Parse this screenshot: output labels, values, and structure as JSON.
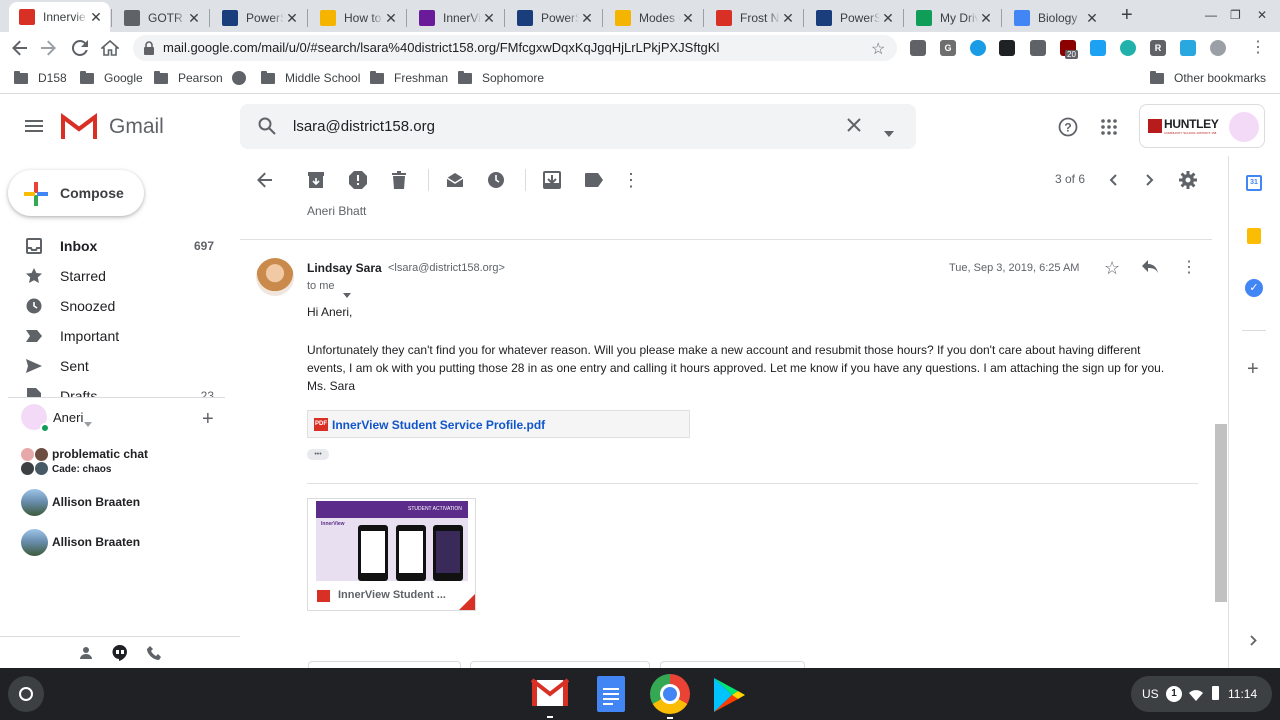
{
  "browser": {
    "tabs": [
      {
        "label": "Innervie",
        "icon": "gmail-icon",
        "color": "#d93025"
      },
      {
        "label": "GOTR Le",
        "icon": "globe-icon",
        "color": "#5f6368"
      },
      {
        "label": "PowerS",
        "icon": "powerschool-icon",
        "color": "#1a3d7c"
      },
      {
        "label": "How to",
        "icon": "slides-icon",
        "color": "#f4b400"
      },
      {
        "label": "InnerVie",
        "icon": "innerview-icon",
        "color": "#6a1b9a"
      },
      {
        "label": "PowerS",
        "icon": "powerschool-icon",
        "color": "#1a3d7c"
      },
      {
        "label": "Modes c",
        "icon": "slides-icon",
        "color": "#f4b400"
      },
      {
        "label": "Frost N",
        "icon": "pdf-icon",
        "color": "#d93025"
      },
      {
        "label": "PowerS",
        "icon": "powerschool-icon",
        "color": "#1a3d7c"
      },
      {
        "label": "My Driv",
        "icon": "drive-icon",
        "color": "#0f9d58"
      },
      {
        "label": "Biology",
        "icon": "docs-icon",
        "color": "#4285f4"
      }
    ],
    "url": "mail.google.com/mail/u/0/#search/lsara%40district158.org/FMfcgxwDqxKqJgqHjLrLPkjPXJSftgKl",
    "extension_badge": "20",
    "bookmarks": [
      "D158",
      "Google",
      "Pearson",
      "",
      "Middle School",
      "Freshman",
      "Sophomore"
    ],
    "other_bookmarks": "Other bookmarks"
  },
  "gmail": {
    "logo_text": "Gmail",
    "search_value": "lsara@district158.org",
    "account_logo": "HUNTLEY",
    "account_logo_sub": "COMMUNITY SCHOOL DISTRICT 158",
    "compose_label": "Compose",
    "nav": [
      {
        "label": "Inbox",
        "count": "697",
        "icon": "inbox-icon"
      },
      {
        "label": "Starred",
        "count": "",
        "icon": "star-icon"
      },
      {
        "label": "Snoozed",
        "count": "",
        "icon": "clock-icon"
      },
      {
        "label": "Important",
        "count": "",
        "icon": "important-icon"
      },
      {
        "label": "Sent",
        "count": "",
        "icon": "send-icon"
      },
      {
        "label": "Drafts",
        "count": "23",
        "icon": "draft-icon"
      }
    ],
    "hangouts": {
      "user": "Aneri",
      "chats": [
        {
          "name": "problematic chat",
          "sub": "Cade: chaos"
        },
        {
          "name": "Allison Braaten",
          "sub": ""
        },
        {
          "name": "Allison Braaten",
          "sub": ""
        }
      ]
    },
    "pager": "3 of 6",
    "prev_sender": "Aneri Bhatt",
    "message": {
      "sender": "Lindsay Sara",
      "email": "<lsara@district158.org>",
      "to": "to me",
      "date": "Tue, Sep 3, 2019, 6:25 AM",
      "greeting": "Hi Aneri,",
      "body": "Unfortunately they can't find you for whatever reason.  Will you please make a new account and resubmit those hours?  If you don't care about having different events, I am ok with you putting those 28 in as one entry and calling it hours approved.  Let me know if you have any questions.  I am attaching the sign up for you.  Ms. Sara",
      "attachment_link": "InnerView Student Service Profile.pdf",
      "ellipsis": "•••",
      "thumb_caption": "InnerView Student ...",
      "thumb_header": "STUDENT ACTIVATION",
      "thumb_brand": "InnerView"
    }
  },
  "shelf": {
    "locale": "US",
    "notif": "1",
    "time": "11:14"
  }
}
